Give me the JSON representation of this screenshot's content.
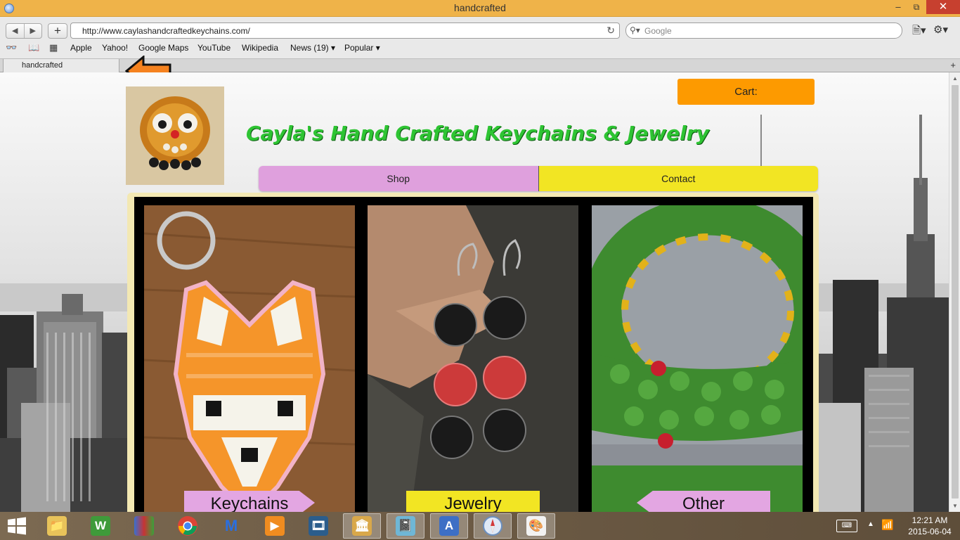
{
  "window": {
    "title": "handcrafted"
  },
  "toolbar": {
    "url": "http://www.caylashandcraftedkeychains.com/",
    "search_placeholder": "Google"
  },
  "bookmarks": [
    "Apple",
    "Yahoo!",
    "Google Maps",
    "YouTube",
    "Wikipedia",
    "News (19)",
    "Popular"
  ],
  "tabs": [
    {
      "label": "handcrafted"
    }
  ],
  "site": {
    "title": "Cayla's Hand Crafted Keychains & Jewelry",
    "cart_label": "Cart:",
    "nav": [
      {
        "label": "Shop",
        "color": "#dfa0dd"
      },
      {
        "label": "Contact",
        "color": "#f2e523"
      }
    ],
    "categories": [
      {
        "label": "Keychains",
        "color": "#e3a6e2"
      },
      {
        "label": "Jewelry",
        "color": "#f2e523"
      },
      {
        "label": "Other",
        "color": "#e3a6e2"
      }
    ]
  },
  "taskbar": {
    "apps": [
      "file-explorer",
      "wordweb",
      "winrar",
      "chrome",
      "malwarebytes",
      "media-player",
      "video-editor",
      "bank-app",
      "notebook",
      "word-document",
      "safari",
      "paint"
    ],
    "clock_time": "12:21 AM",
    "clock_date": "2015-06-04"
  },
  "colors": {
    "titlebar": "#efb349",
    "cart": "#fd9a00",
    "title_green": "#2ec433",
    "close": "#c7402f"
  }
}
